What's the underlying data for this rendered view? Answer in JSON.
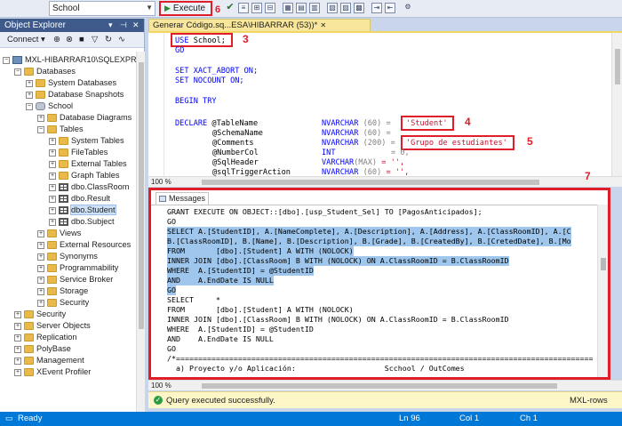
{
  "toolbar": {
    "database": "School",
    "execute_label": "Execute",
    "execute_badge": "6"
  },
  "object_explorer": {
    "title": "Object Explorer",
    "connect_label": "Connect",
    "tree": [
      {
        "label": "MXL-HIBARRAR10\\SQLEXPRESS",
        "kind": "server"
      },
      {
        "label": "Databases",
        "kind": "folder"
      },
      {
        "label": "System Databases",
        "kind": "folder"
      },
      {
        "label": "Database Snapshots",
        "kind": "folder"
      },
      {
        "label": "School",
        "kind": "db"
      },
      {
        "label": "Database Diagrams",
        "kind": "folder"
      },
      {
        "label": "Tables",
        "kind": "folder"
      },
      {
        "label": "System Tables",
        "kind": "folder"
      },
      {
        "label": "FileTables",
        "kind": "folder"
      },
      {
        "label": "External Tables",
        "kind": "folder"
      },
      {
        "label": "Graph Tables",
        "kind": "folder"
      },
      {
        "label": "dbo.ClassRoom",
        "kind": "table"
      },
      {
        "label": "dbo.Result",
        "kind": "table"
      },
      {
        "label": "dbo.Student",
        "kind": "table"
      },
      {
        "label": "dbo.Subject",
        "kind": "table"
      },
      {
        "label": "Views",
        "kind": "folder"
      },
      {
        "label": "External Resources",
        "kind": "folder"
      },
      {
        "label": "Synonyms",
        "kind": "folder"
      },
      {
        "label": "Programmability",
        "kind": "folder"
      },
      {
        "label": "Service Broker",
        "kind": "folder"
      },
      {
        "label": "Storage",
        "kind": "folder"
      },
      {
        "label": "Security",
        "kind": "folder"
      },
      {
        "label": "Security",
        "kind": "folder"
      },
      {
        "label": "Server Objects",
        "kind": "folder"
      },
      {
        "label": "Replication",
        "kind": "folder"
      },
      {
        "label": "PolyBase",
        "kind": "folder"
      },
      {
        "label": "Management",
        "kind": "folder"
      },
      {
        "label": "XEvent Profiler",
        "kind": "folder"
      }
    ]
  },
  "editor": {
    "tab_title": "Generar Código.sq...ESA\\HIBARRAR (53))*",
    "lines": {
      "l1_kw": "USE",
      "l1_rest": " School;",
      "l2": "GO",
      "l3": "SET XACT_ABORT ON;",
      "l4": "SET NOCOUNT ON;",
      "l5": "BEGIN TRY",
      "l6_kw": "DECLARE",
      "l6_var": " @TableName",
      "l6_type": "NVARCHAR",
      "l6_size": " (60)",
      "l6_eq": " = ",
      "l6_val": "'Student'",
      "l7_var": "@SchemaName",
      "l7_type": "NVARCHAR",
      "l7_size": " (60)",
      "l7_eq": " =",
      "l8_var": "@Comments",
      "l8_type": "NVARCHAR",
      "l8_size": " (200)",
      "l8_eq": " = ",
      "l8_val": "'Grupo de estudiantes'",
      "l9_var": "@NumberCol",
      "l9_type": "INT",
      "l9_eq": "= 0,",
      "l10_var": "@SqlHeader",
      "l10_type": "VARCHAR",
      "l10_size": "(MAX)",
      "l10_eq": " = '',",
      "l11_var": "@sqlTriggerAction",
      "l11_type": "NVARCHAR",
      "l11_size": " (60)",
      "l11_eq": " = '',"
    },
    "badges": {
      "b3": "3",
      "b4": "4",
      "b5": "5"
    },
    "zoom": "100 %"
  },
  "messages": {
    "tab_label": "Messages",
    "badge": "7",
    "lines": [
      "GRANT EXECUTE ON OBJECT::[dbo].[usp_Student_Sel] TO [PagosAnticipados];",
      "GO",
      "SELECT A.[StudentID], A.[NameComplete], A.[Description], A.[Address], A.[ClassRoomID], A.[C",
      "B.[ClassRoomID], B.[Name], B.[Description], B.[Grade], B.[CreatedBy], B.[CretedDate], B.[Mo",
      "FROM       [dbo].[Student] A WITH (NOLOCK)",
      "INNER JOIN [dbo].[ClassRoom] B WITH (NOLOCK) ON A.ClassRoomID = B.ClassRoomID",
      "WHERE  A.[StudentID] = @StudentID",
      "AND    A.EndDate IS NULL",
      "GO",
      "SELECT     *",
      "FROM       [dbo].[Student] A WITH (NOLOCK)",
      "INNER JOIN [dbo].[ClassRoom] B WITH (NOLOCK) ON A.ClassRoomID = B.ClassRoomID",
      "WHERE  A.[StudentID] = @StudentID",
      "AND    A.EndDate IS NULL",
      "GO",
      "/*==============================================================================================",
      "  a) Proyecto y/o Aplicación:                    Scchool / OutComes"
    ],
    "zoom": "100 %"
  },
  "query_status": {
    "text": "Query executed successfully.",
    "server": "MXL-rows"
  },
  "statusbar": {
    "ready": "Ready",
    "ln": "Ln 96",
    "col": "Col 1",
    "ch": "Ch 1"
  },
  "colors": {
    "accent_red": "#e01e2a",
    "status_blue": "#0078d7",
    "highlight": "#9fc6ec"
  }
}
